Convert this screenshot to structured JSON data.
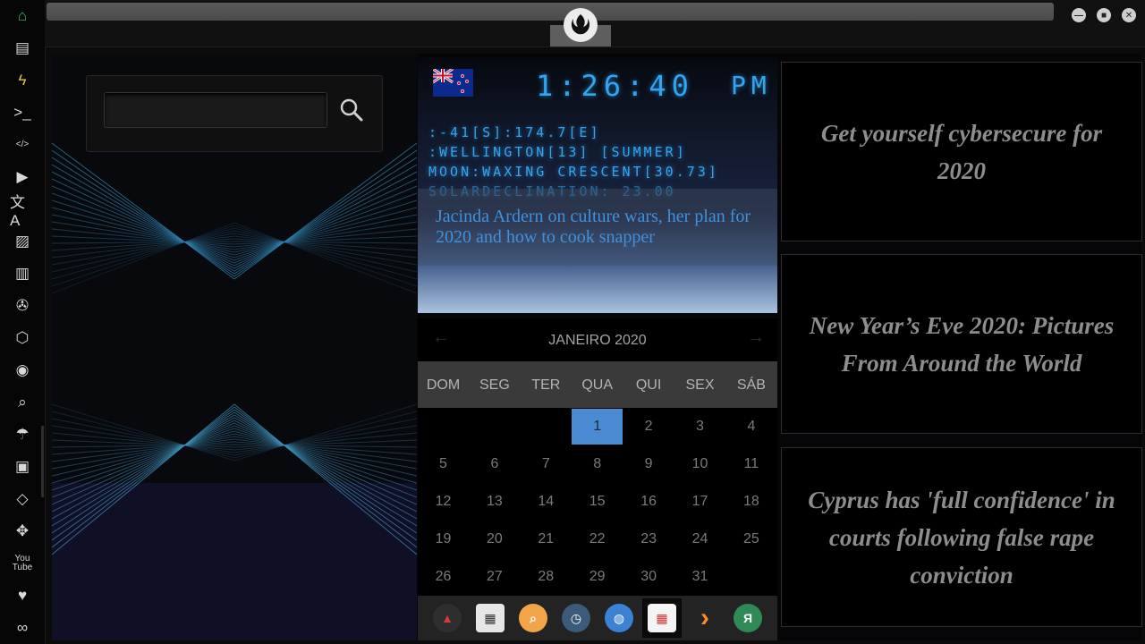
{
  "sidebar": {
    "items": [
      {
        "icon": "home-icon",
        "glyph": "⌂",
        "color": "#3fbf5a"
      },
      {
        "icon": "document-icon",
        "glyph": "▤"
      },
      {
        "icon": "lightning-icon",
        "glyph": "ϟ",
        "color": "#e6c23a"
      },
      {
        "icon": "terminal-icon",
        "glyph": ">_"
      },
      {
        "icon": "code-icon",
        "glyph": "</>"
      },
      {
        "icon": "play-icon",
        "glyph": "▶"
      },
      {
        "icon": "translate-icon",
        "glyph": "文A"
      },
      {
        "icon": "image-icon",
        "glyph": "▨"
      },
      {
        "icon": "newspaper-icon",
        "glyph": "▥"
      },
      {
        "icon": "rebel-alliance-icon",
        "glyph": "✇"
      },
      {
        "icon": "empire-icon",
        "glyph": "⬡"
      },
      {
        "icon": "globe-icon",
        "glyph": "◉"
      },
      {
        "icon": "search-icon",
        "glyph": "⌕"
      },
      {
        "icon": "umbrella-icon",
        "glyph": "☂"
      },
      {
        "icon": "contacts-icon",
        "glyph": "▣"
      },
      {
        "icon": "code-diamond-icon",
        "glyph": "◇"
      },
      {
        "icon": "fullscreen-icon",
        "glyph": "✥"
      },
      {
        "icon": "youtube-icon",
        "glyph": "You\nTube"
      },
      {
        "icon": "heart-icon",
        "glyph": "♥"
      },
      {
        "icon": "infinity-cloud-icon",
        "glyph": "∞"
      }
    ]
  },
  "window": {
    "logo_icon": "rebel-alliance-icon",
    "controls": [
      "minimize-icon",
      "maximize-icon",
      "close-icon"
    ]
  },
  "search": {
    "value": "",
    "placeholder": ""
  },
  "clock": {
    "time": "1:26:40",
    "ampm": "PM",
    "lines": [
      ":-41[S]:174.7[E]",
      ":WELLINGTON[13] [SUMMER]",
      "MOON:WAXING CRESCENT[30.73]",
      "SOLARDECLINATION: 23.00"
    ],
    "headline": "Jacinda Ardern on culture wars, her plan for 2020 and how to cook snapper"
  },
  "calendar": {
    "title": "JANEIRO 2020",
    "prev": "←",
    "next": "→",
    "weekdays": [
      "DOM",
      "SEG",
      "TER",
      "QUA",
      "QUI",
      "SEX",
      "SÁB"
    ],
    "rows": [
      [
        "",
        "",
        "",
        "1",
        "2",
        "3",
        "4"
      ],
      [
        "5",
        "6",
        "7",
        "8",
        "9",
        "10",
        "11"
      ],
      [
        "12",
        "13",
        "14",
        "15",
        "16",
        "17",
        "18"
      ],
      [
        "19",
        "20",
        "21",
        "22",
        "23",
        "24",
        "25"
      ],
      [
        "26",
        "27",
        "28",
        "29",
        "30",
        "31",
        ""
      ]
    ],
    "today": "1"
  },
  "dock": {
    "items": [
      {
        "icon": "ark-app-icon",
        "glyph": "▲",
        "color": "#d63a3a",
        "bg": "#2e2e2e"
      },
      {
        "icon": "news-reader-icon",
        "glyph": "▦",
        "color": "#333",
        "bg": "#e6e6e6"
      },
      {
        "icon": "magnifier-app-icon",
        "glyph": "⌕",
        "color": "#fff",
        "bg": "#f2a449"
      },
      {
        "icon": "clock-app-icon",
        "glyph": "◷",
        "color": "#fff",
        "bg": "#3c5a7a"
      },
      {
        "icon": "browser-globe-icon",
        "glyph": "◍",
        "color": "#fff",
        "bg": "#3b82d6"
      },
      {
        "icon": "calendar-app-icon",
        "glyph": "▦",
        "color": "#c33",
        "bg": "#f4f4f4",
        "active": true
      },
      {
        "icon": "forward-arrow-icon",
        "glyph": "›",
        "color": "#ff8c2a",
        "bg": "transparent"
      },
      {
        "icon": "yandex-icon",
        "glyph": "Я",
        "color": "#fff",
        "bg": "#2f8a55"
      }
    ]
  },
  "news": [
    {
      "title": "Get yourself cybersecure for 2020"
    },
    {
      "title": "New Year’s Eve 2020: Pictures From Around the World"
    },
    {
      "title": "Cyprus has 'full confidence' in courts following false rape conviction"
    }
  ]
}
